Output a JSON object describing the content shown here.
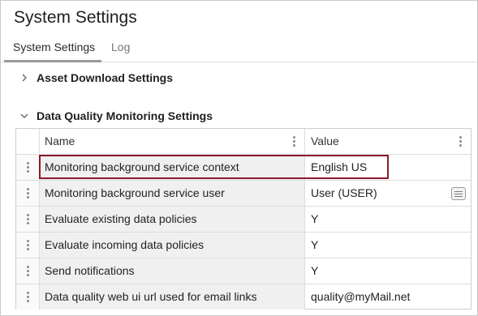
{
  "window": {
    "title": "System Settings"
  },
  "tabs": [
    {
      "label": "System Settings"
    },
    {
      "label": "Log"
    }
  ],
  "sections": [
    {
      "label": "Asset Download Settings"
    },
    {
      "label": "Data Quality Monitoring Settings"
    }
  ],
  "grid": {
    "columns": [
      {
        "label": "Name"
      },
      {
        "label": "Value"
      }
    ],
    "rows": [
      {
        "name": "Monitoring background service context",
        "value": "English US"
      },
      {
        "name": "Monitoring background service user",
        "value": "User (USER)"
      },
      {
        "name": "Evaluate existing data policies",
        "value": "Y"
      },
      {
        "name": "Evaluate incoming data policies",
        "value": "Y"
      },
      {
        "name": "Send notifications",
        "value": "Y"
      },
      {
        "name": "Data quality web ui url used for email links",
        "value": "quality@myMail.net"
      }
    ]
  },
  "icons": {
    "expand": "chevron-right-icon",
    "collapse": "chevron-down-icon",
    "drag": "drag-handle-icon",
    "column_menu": "column-menu-icon",
    "picker": "picker-icon"
  },
  "colors": {
    "highlight": "#8b1a2b"
  }
}
